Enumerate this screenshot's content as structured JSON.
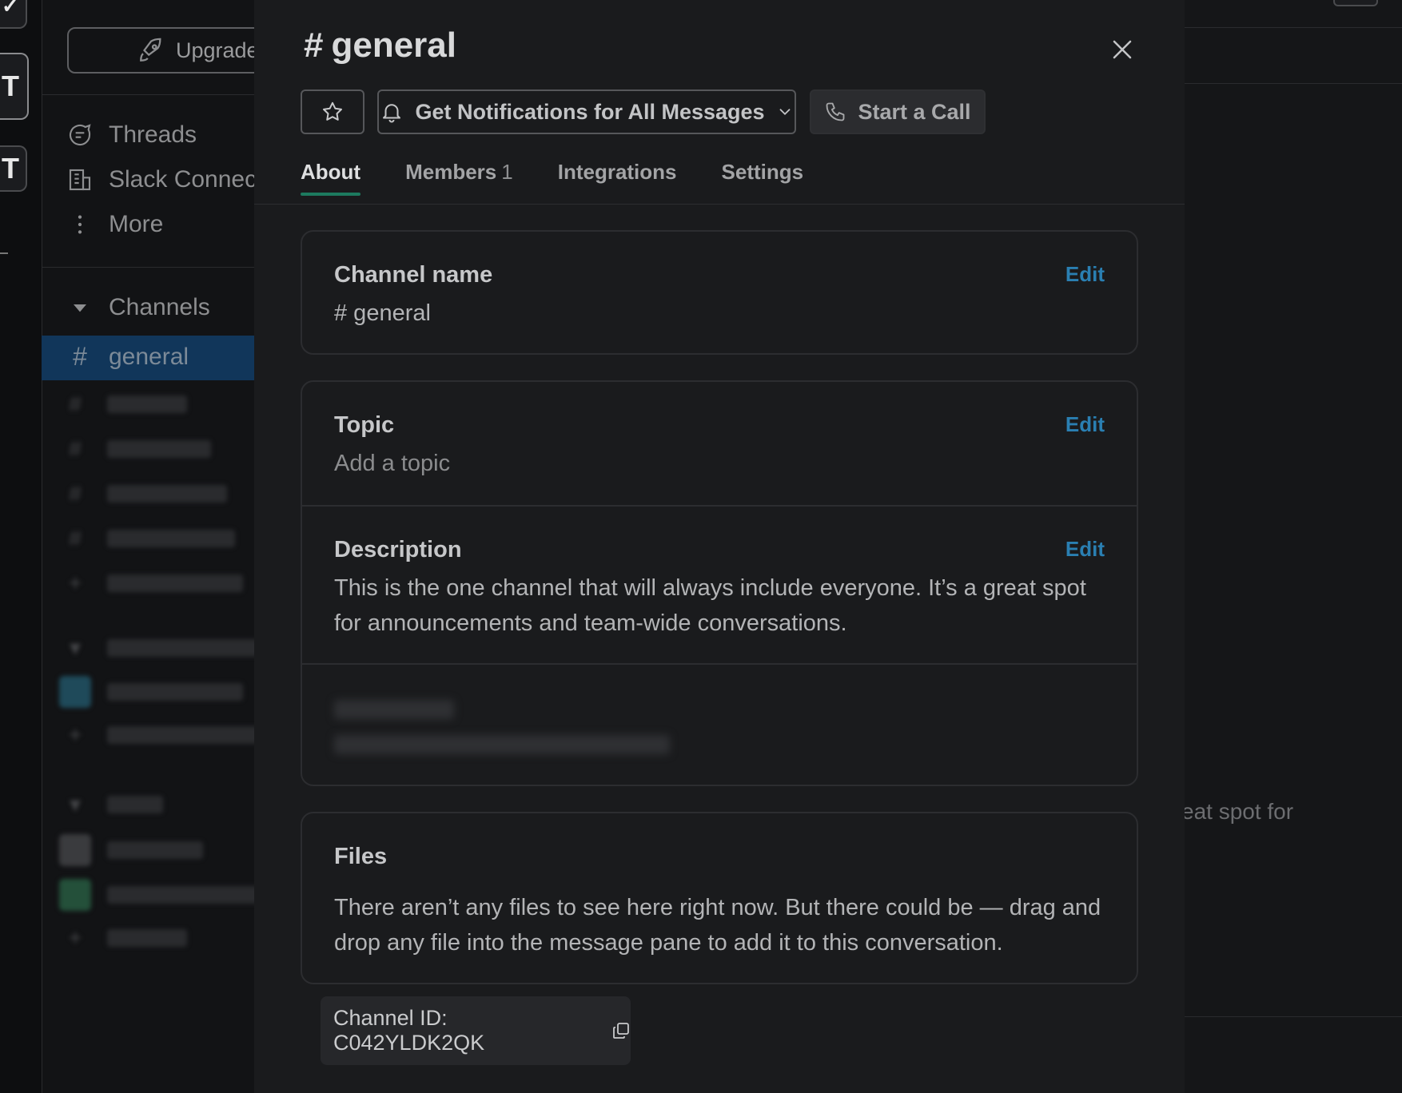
{
  "sidebar": {
    "upgrade_label": "Upgrade",
    "nav": [
      {
        "label": "Threads",
        "icon": "threads-icon"
      },
      {
        "label": "Slack Connect",
        "icon": "building-icon"
      },
      {
        "label": "More",
        "icon": "more-icon"
      }
    ],
    "channels_header": "Channels",
    "active_channel": "general",
    "workspace_initial": "T"
  },
  "background": {
    "message_fragment": "eat spot for"
  },
  "modal": {
    "title_hash": "#",
    "title": "general",
    "notifications_label": "Get Notifications for All Messages",
    "call_label": "Start a Call",
    "tabs": [
      {
        "label": "About",
        "count": ""
      },
      {
        "label": "Members",
        "count": "1"
      },
      {
        "label": "Integrations",
        "count": ""
      },
      {
        "label": "Settings",
        "count": ""
      }
    ],
    "channel_name": {
      "label": "Channel name",
      "value": "# general",
      "edit": "Edit"
    },
    "topic": {
      "label": "Topic",
      "value": "Add a topic",
      "edit": "Edit"
    },
    "description": {
      "label": "Description",
      "value": "This is the one channel that will always include everyone. It’s a great spot for announcements and team-wide conversations.",
      "edit": "Edit"
    },
    "files": {
      "label": "Files",
      "value": "There aren’t any files to see here right now. But there could be — drag and drop any file into the message pane to add it to this conversation."
    },
    "channel_id": "Channel ID: C042YLDK2QK"
  },
  "colors": {
    "accent_tab": "#1d7a5f",
    "edit_link": "#2a7fb2",
    "active_channel_bg": "#11365a"
  }
}
